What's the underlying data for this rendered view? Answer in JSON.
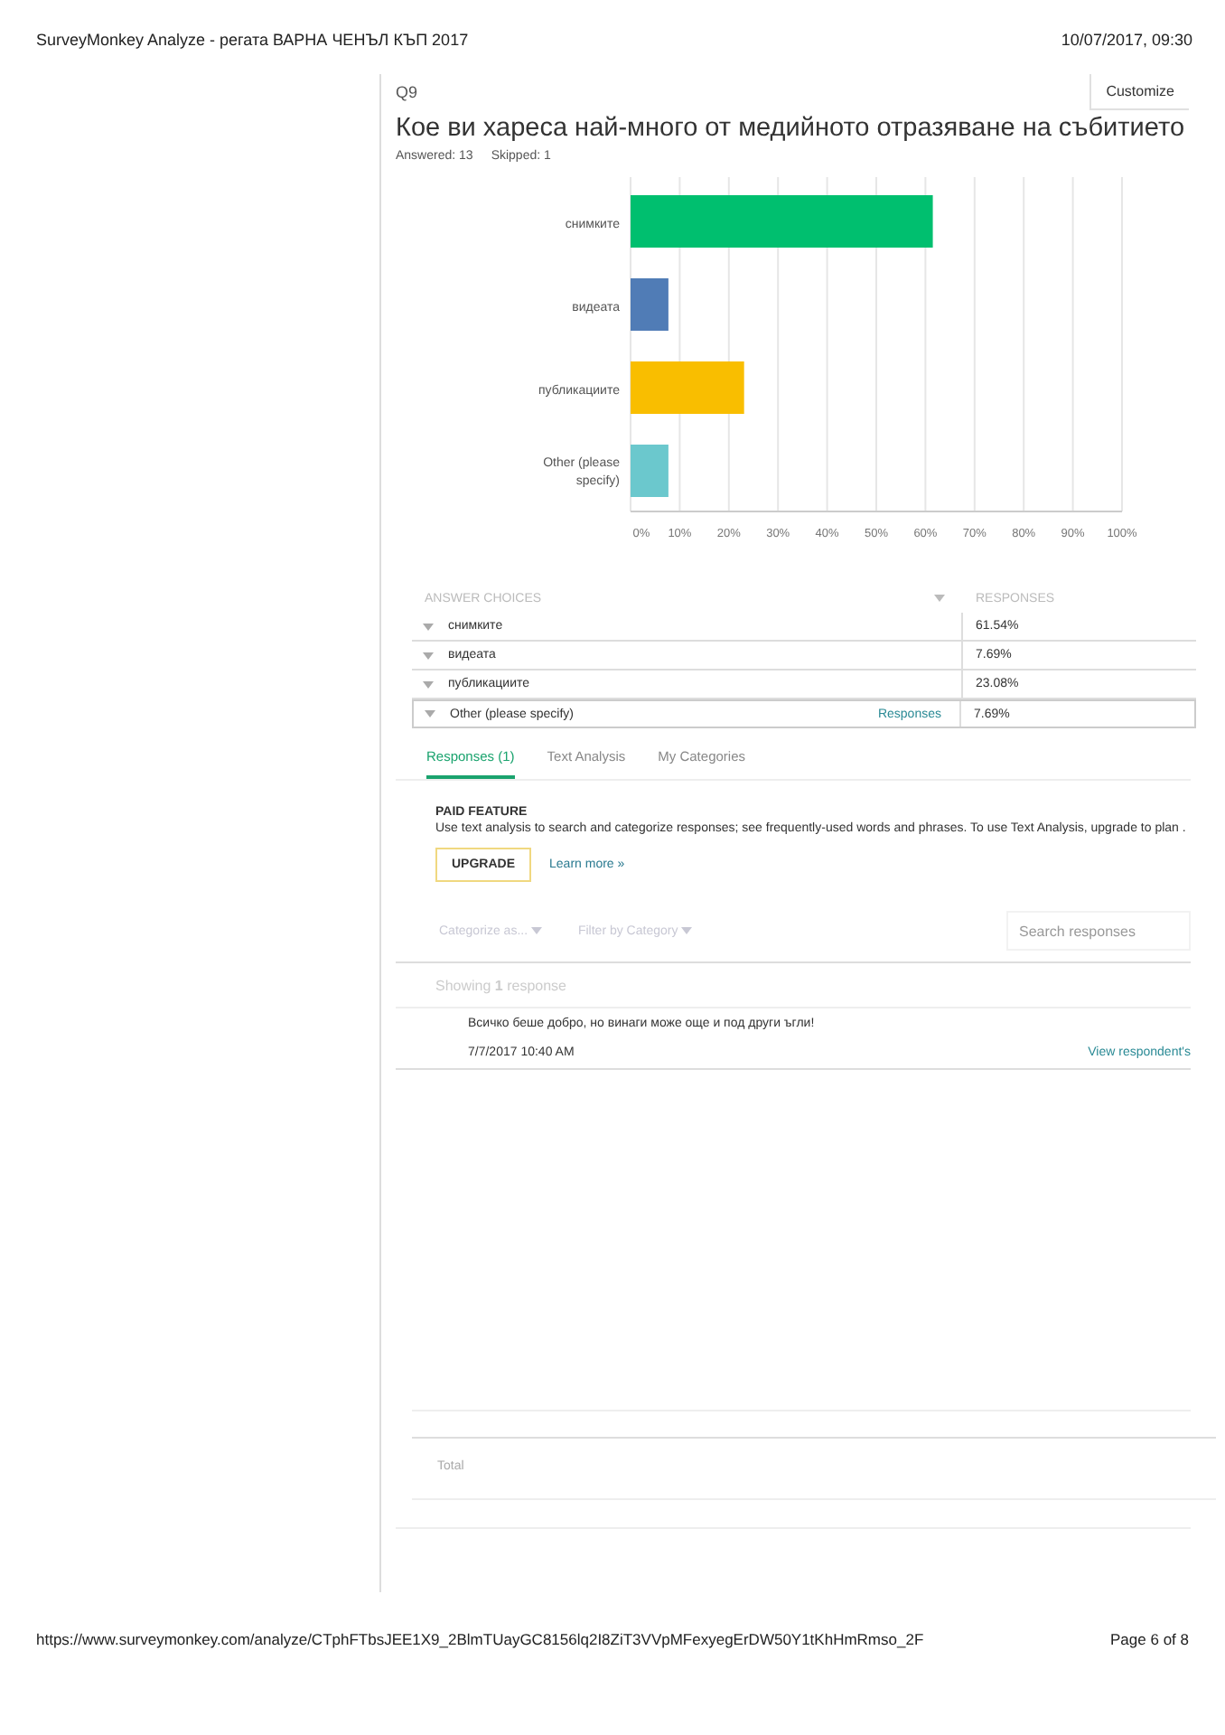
{
  "header": {
    "title": "SurveyMonkey Analyze - регата ВАРНА ЧЕНЪЛ КЪП 2017",
    "datetime": "10/07/2017, 09:30"
  },
  "question": {
    "number": "Q9",
    "customize": "Customize",
    "title": "Кое ви хареса най-много от медийното отразяване на събитието",
    "answered": "Answered: 13",
    "skipped": "Skipped: 1",
    "chart_data": {
      "type": "bar",
      "orientation": "horizontal",
      "categories": [
        "снимките",
        "видеата",
        "публикациите",
        "Other (please specify)"
      ],
      "colors": [
        "#00bf6f",
        "#507cb6",
        "#f9be00",
        "#6bc8cd"
      ],
      "series": [
        {
          "values": [
            61.5,
            7.7,
            23.1,
            7.7
          ]
        }
      ],
      "grid": true,
      "xlim": [
        0,
        100
      ],
      "xticks": [
        {
          "value": 0,
          "label": "0%"
        },
        {
          "value": 10,
          "label": "10%"
        },
        {
          "value": 20,
          "label": "20%"
        },
        {
          "value": 30,
          "label": "30%"
        },
        {
          "value": 40,
          "label": "40%"
        },
        {
          "value": 50,
          "label": "50%"
        },
        {
          "value": 60,
          "label": "60%"
        },
        {
          "value": 70,
          "label": "70%"
        },
        {
          "value": 80,
          "label": "80%"
        },
        {
          "value": 90,
          "label": "90%"
        },
        {
          "value": 100,
          "label": "100%"
        }
      ]
    }
  },
  "table": {
    "columns": [
      "ANSWER CHOICES",
      "RESPONSES"
    ],
    "rows": [
      {
        "choice": "снимките",
        "response": "61.54%",
        "selected": false
      },
      {
        "choice": "видеата",
        "response": "7.69%",
        "selected": false
      },
      {
        "choice": "публикациите",
        "response": "23.08%",
        "selected": false
      },
      {
        "choice": "Other (please specify)",
        "link": "Responses",
        "response": "7.69%",
        "selected": true
      }
    ],
    "total": "Total"
  },
  "tabs": [
    {
      "label": "Responses (1)",
      "selected": true
    },
    {
      "label": "Text Analysis",
      "selected": false
    },
    {
      "label": "My Categories",
      "selected": false
    }
  ],
  "paid": {
    "title": "PAID FEATURE",
    "text": "Use text analysis to search and categorize responses; see frequently-used words and phrases. To use Text Analysis, upgrade to plan .",
    "upgrade": "UPGRADE",
    "learn": "Learn more »"
  },
  "filters": {
    "categorize": "Categorize as...",
    "filter": "Filter by Category",
    "search_placeholder": "Search responses"
  },
  "showing": "Showing **1** response",
  "responses": [
    {
      "text": "Всичко беше добро, но винаги може още и под други ъгли!",
      "date": "7/7/2017 10:40 AM",
      "link": "View respondent's"
    }
  ],
  "footer": {
    "url": "https://www.surveymonkey.com/analyze/CTphFTbsJEE1X9_2BlmTUayGC8156lq2I8ZiT3VVpMFexyegErDW50Y1tKhHmRmso_2F",
    "page": "Page 6 of 8"
  }
}
